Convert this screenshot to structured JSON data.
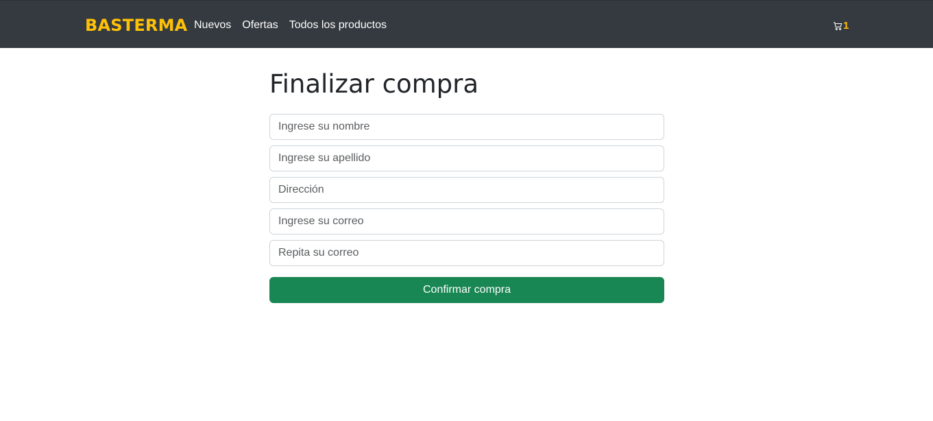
{
  "navbar": {
    "brand": "BASTERMA",
    "links": [
      "Nuevos",
      "Ofertas",
      "Todos los productos"
    ],
    "cart": {
      "icon": "cart-icon",
      "count": "1"
    }
  },
  "main": {
    "title": "Finalizar compra",
    "fields": [
      {
        "placeholder": "Ingrese su nombre",
        "value": ""
      },
      {
        "placeholder": "Ingrese su apellido",
        "value": ""
      },
      {
        "placeholder": "Dirección",
        "value": ""
      },
      {
        "placeholder": "Ingrese su correo",
        "value": ""
      },
      {
        "placeholder": "Repita su correo",
        "value": ""
      }
    ],
    "submit_label": "Confirmar compra"
  },
  "colors": {
    "navbar_bg": "#343a40",
    "brand": "#ffc107",
    "cart_count": "#ffc107",
    "submit_bg": "#198754"
  }
}
